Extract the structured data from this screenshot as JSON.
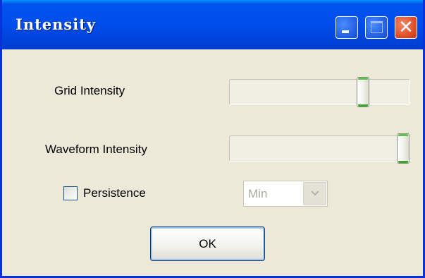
{
  "window": {
    "title": "Intensity",
    "controls": {
      "minimize_icon": "minimize-icon",
      "maximize_icon": "maximize-icon",
      "close_icon": "close-icon"
    }
  },
  "grid_intensity": {
    "label": "Grid Intensity",
    "value_fraction": 0.76
  },
  "waveform_intensity": {
    "label": "Waveform Intensity",
    "value_fraction": 1.0
  },
  "persistence": {
    "label": "Persistence",
    "checked": false,
    "select_value": "Min",
    "select_enabled": false
  },
  "ok_button": {
    "label": "OK"
  },
  "colors": {
    "title_bar": "#0053ee",
    "window_bg": "#ece9d8",
    "close_button": "#e0502a",
    "slider_thumb_accent": "#5ec24e"
  }
}
